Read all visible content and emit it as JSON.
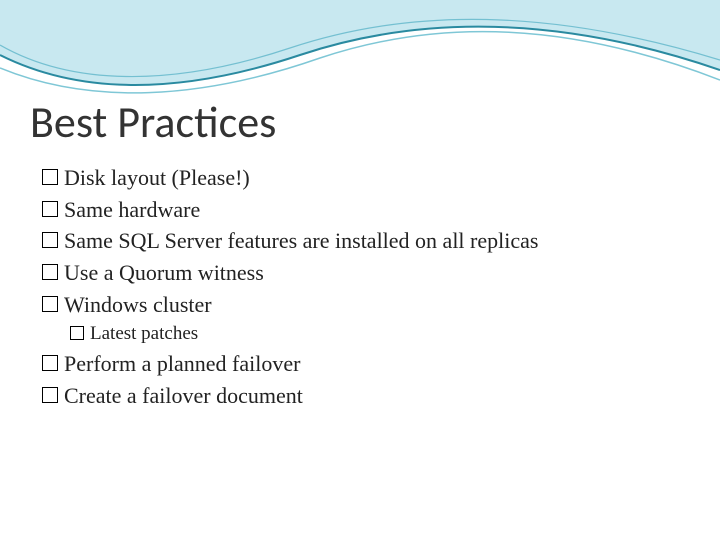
{
  "title": "Best Practices",
  "bullets": [
    {
      "text": "Disk layout (Please!)",
      "level": 0
    },
    {
      "text": "Same hardware",
      "level": 0
    },
    {
      "text": "Same SQL Server features are installed on all replicas",
      "level": 0
    },
    {
      "text": "Use a Quorum witness",
      "level": 0
    },
    {
      "text": "Windows cluster",
      "level": 0
    },
    {
      "text": "Latest patches",
      "level": 1
    },
    {
      "text": "Perform a planned failover",
      "level": 0
    },
    {
      "text": "Create a failover document",
      "level": 0
    }
  ]
}
